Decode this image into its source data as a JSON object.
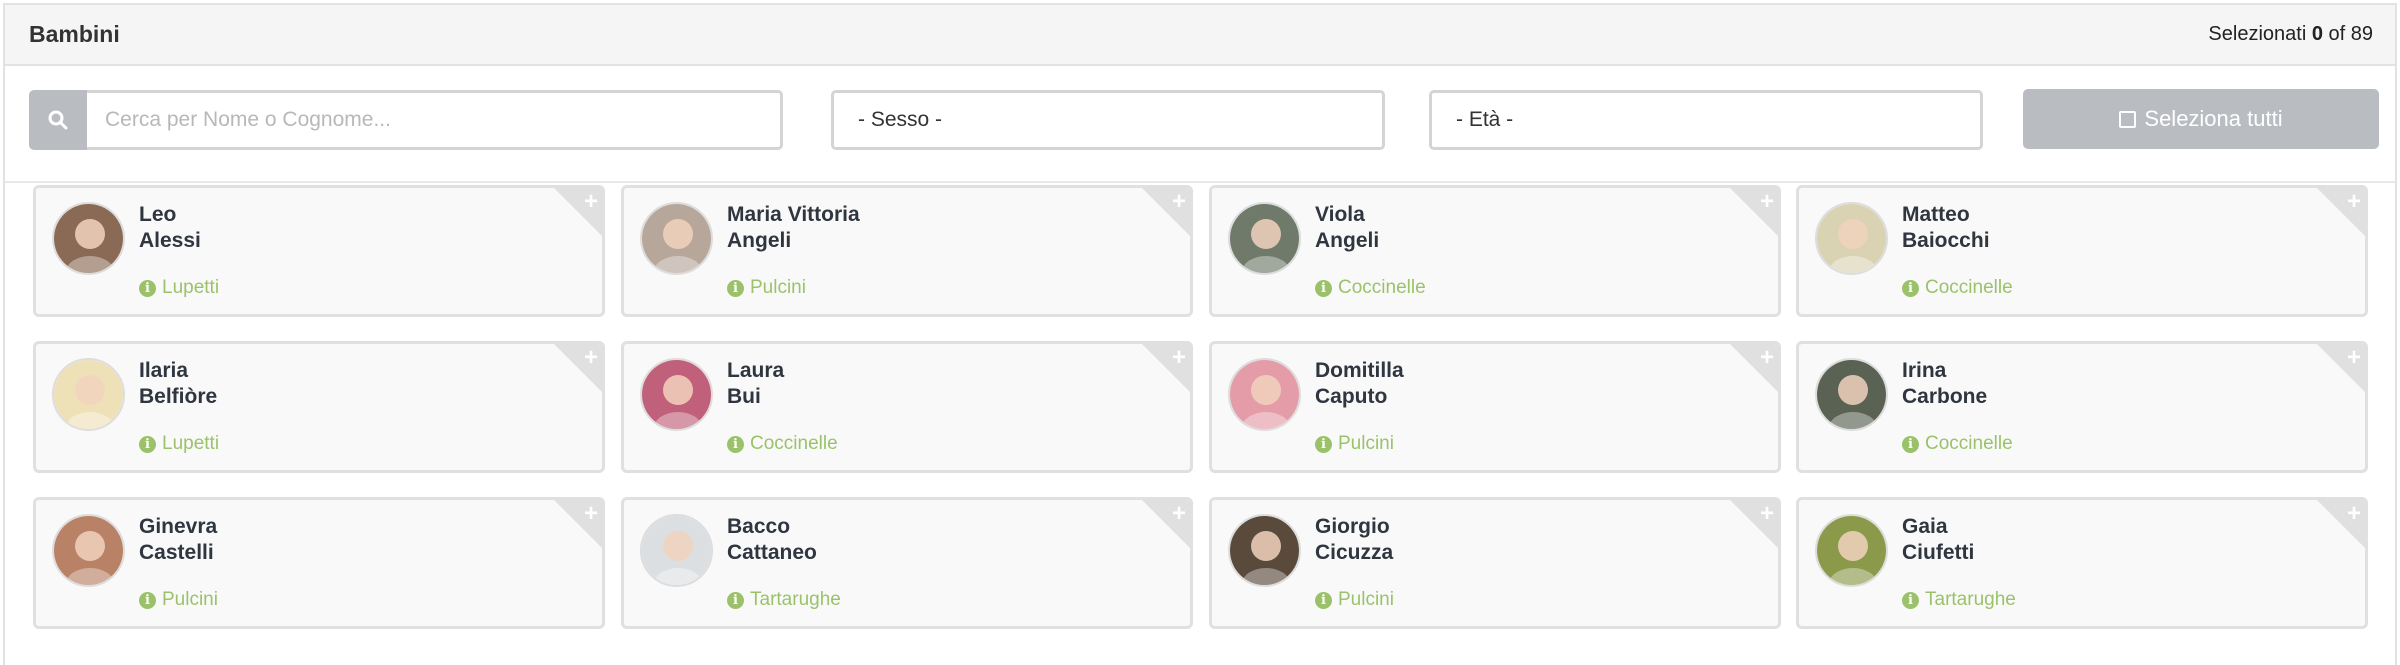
{
  "header": {
    "title": "Bambini",
    "selected_prefix": "Selezionati ",
    "selected_count": "0",
    "selected_suffix": " of 89"
  },
  "filters": {
    "search_placeholder": "Cerca per Nome o Cognome...",
    "search_icon": "search-icon",
    "sex_select": "- Sesso -",
    "age_select": "- Età -",
    "select_all": "Seleziona tutti"
  },
  "children": [
    {
      "first": "Leo",
      "last": "Alessi",
      "group": "Lupetti",
      "avatar_color": "#8a6a55"
    },
    {
      "first": "Maria Vittoria",
      "last": "Angeli",
      "group": "Pulcini",
      "avatar_color": "#b7a79b"
    },
    {
      "first": "Viola",
      "last": "Angeli",
      "group": "Coccinelle",
      "avatar_color": "#6f7a6a"
    },
    {
      "first": "Matteo",
      "last": "Baiocchi",
      "group": "Coccinelle",
      "avatar_color": "#d9d3b4"
    },
    {
      "first": "Ilaria",
      "last": "Belfiòre",
      "group": "Lupetti",
      "avatar_color": "#efe1b7"
    },
    {
      "first": "Laura",
      "last": "Bui",
      "group": "Coccinelle",
      "avatar_color": "#c0607a"
    },
    {
      "first": "Domitilla",
      "last": "Caputo",
      "group": "Pulcini",
      "avatar_color": "#e49ca8"
    },
    {
      "first": "Irina",
      "last": "Carbone",
      "group": "Coccinelle",
      "avatar_color": "#5a6254"
    },
    {
      "first": "Ginevra",
      "last": "Castelli",
      "group": "Pulcini",
      "avatar_color": "#b98266"
    },
    {
      "first": "Bacco",
      "last": "Cattaneo",
      "group": "Tartarughe",
      "avatar_color": "#dcdfe2"
    },
    {
      "first": "Giorgio",
      "last": "Cicuzza",
      "group": "Pulcini",
      "avatar_color": "#5a4a3c"
    },
    {
      "first": "Gaia",
      "last": "Ciufetti",
      "group": "Tartarughe",
      "avatar_color": "#8b9a4a"
    }
  ],
  "colors": {
    "accent_green": "#9bc26b",
    "button_gray": "#b9bdc2"
  }
}
